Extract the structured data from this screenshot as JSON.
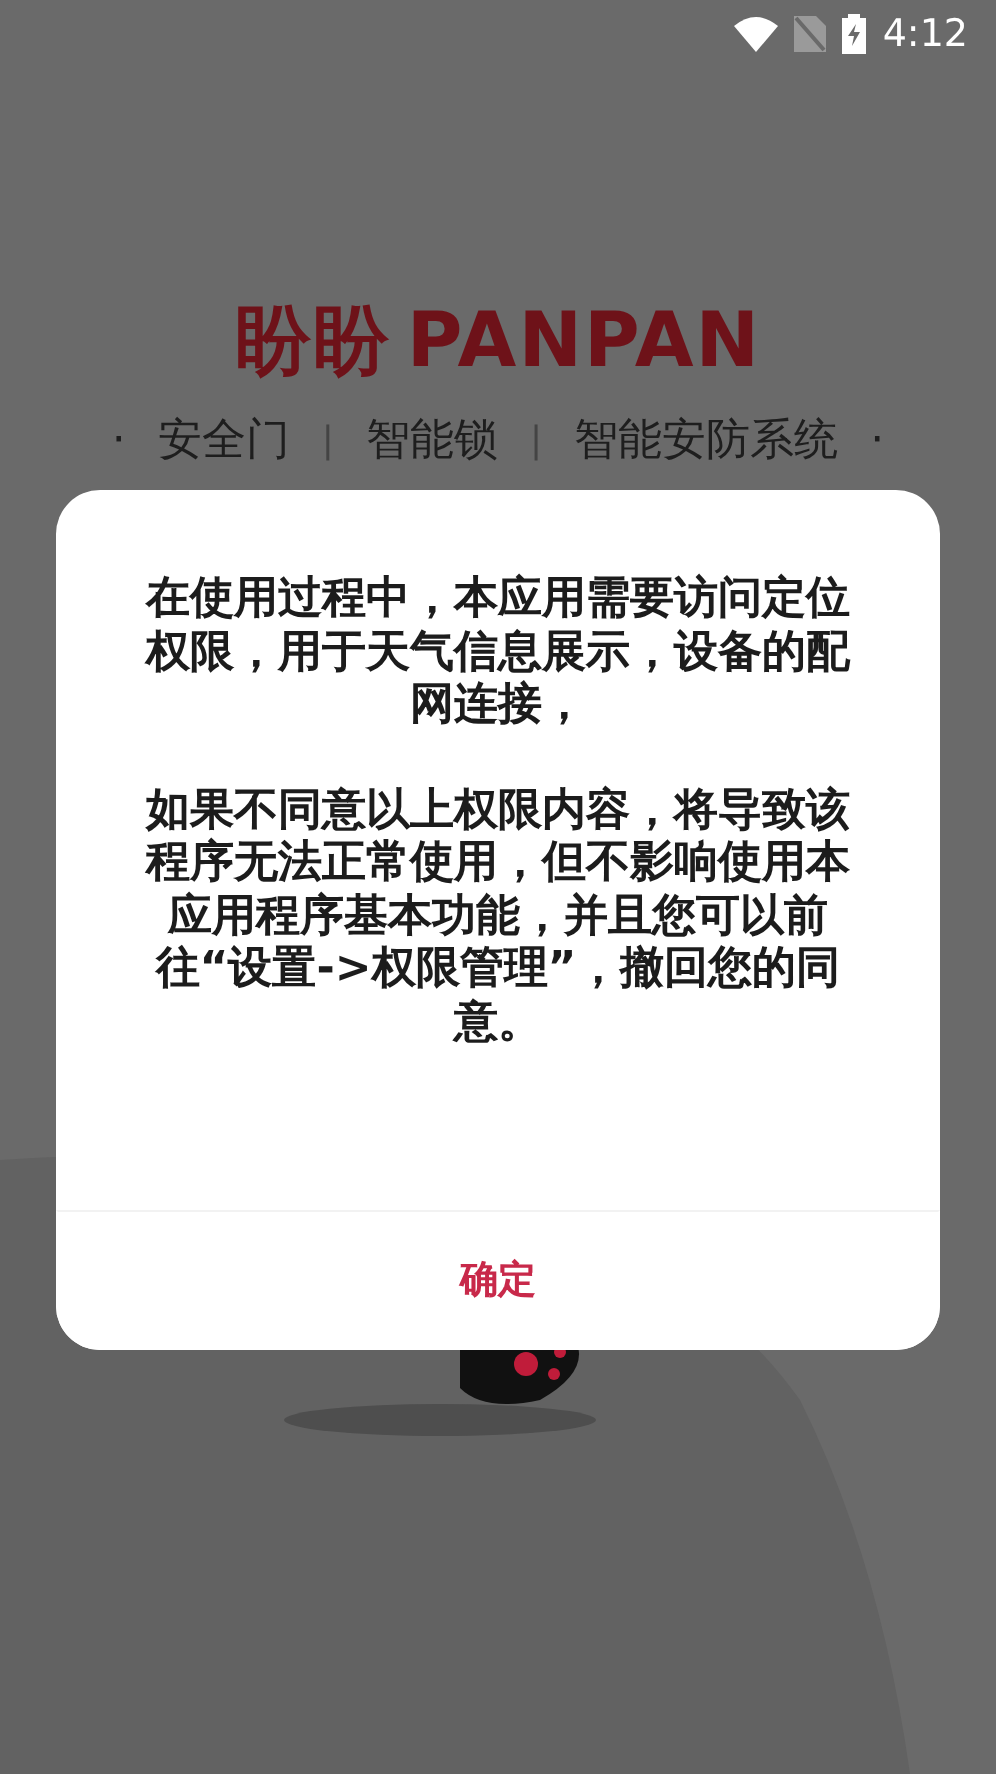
{
  "status_bar": {
    "time": "4:12"
  },
  "logo": {
    "chinese": "盼盼",
    "latin": "PANPAN"
  },
  "tagline": [
    {
      "kind": "dot",
      "text": "·"
    },
    {
      "kind": "item",
      "text": "安全门"
    },
    {
      "kind": "sep",
      "text": "|"
    },
    {
      "kind": "item",
      "text": "智能锁"
    },
    {
      "kind": "sep",
      "text": "|"
    },
    {
      "kind": "item",
      "text": "智能安防系统"
    },
    {
      "kind": "dot",
      "text": "·"
    }
  ],
  "dialog": {
    "paragraphs": [
      "在使用过程中，本应用需要访问定位权限，用于天气信息展示，设备的配网连接，",
      "如果不同意以上权限内容，将导致该程序无法正常使用，但不影响使用本应用程序基本功能，并且您可以前往“设置->权限管理”，撤回您的同意。"
    ],
    "button": "确定"
  }
}
